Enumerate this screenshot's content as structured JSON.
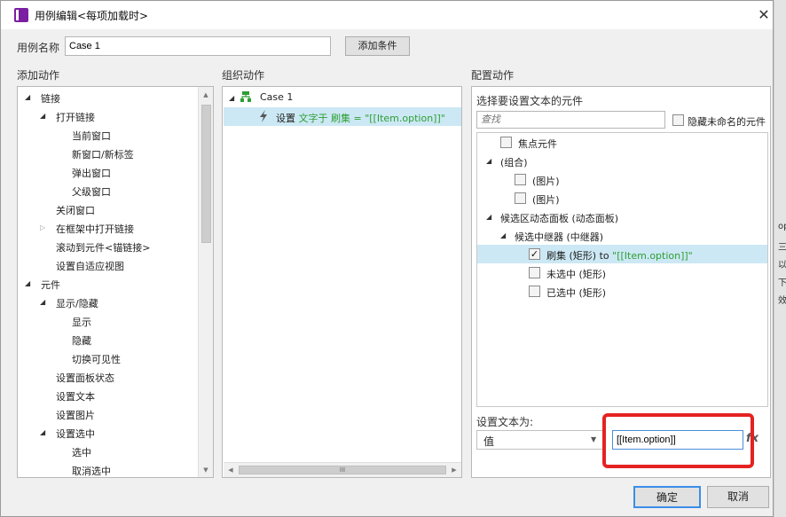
{
  "window": {
    "title": "用例编辑<每项加载时>",
    "icon_label": "RP"
  },
  "case_name": {
    "label": "用例名称",
    "value": "Case 1",
    "add_condition_button": "添加条件"
  },
  "sections": {
    "add_action": "添加动作",
    "organize_action": "组织动作",
    "configure_action": "配置动作"
  },
  "add_actions": [
    {
      "label": "链接",
      "level": 0,
      "expander": "open"
    },
    {
      "label": "打开链接",
      "level": 1,
      "expander": "open"
    },
    {
      "label": "当前窗口",
      "level": 2,
      "expander": "none"
    },
    {
      "label": "新窗口/新标签",
      "level": 2,
      "expander": "none"
    },
    {
      "label": "弹出窗口",
      "level": 2,
      "expander": "none"
    },
    {
      "label": "父级窗口",
      "level": 2,
      "expander": "none"
    },
    {
      "label": "关闭窗口",
      "level": 1,
      "expander": "none"
    },
    {
      "label": "在框架中打开链接",
      "level": 1,
      "expander": "closed"
    },
    {
      "label": "滚动到元件<锚链接>",
      "level": 1,
      "expander": "none"
    },
    {
      "label": "设置自适应视图",
      "level": 1,
      "expander": "none"
    },
    {
      "label": "元件",
      "level": 0,
      "expander": "open"
    },
    {
      "label": "显示/隐藏",
      "level": 1,
      "expander": "open"
    },
    {
      "label": "显示",
      "level": 2,
      "expander": "none"
    },
    {
      "label": "隐藏",
      "level": 2,
      "expander": "none"
    },
    {
      "label": "切换可见性",
      "level": 2,
      "expander": "none"
    },
    {
      "label": "设置面板状态",
      "level": 1,
      "expander": "none"
    },
    {
      "label": "设置文本",
      "level": 1,
      "expander": "none"
    },
    {
      "label": "设置图片",
      "level": 1,
      "expander": "none"
    },
    {
      "label": "设置选中",
      "level": 1,
      "expander": "open"
    },
    {
      "label": "选中",
      "level": 2,
      "expander": "none"
    },
    {
      "label": "取消选中",
      "level": 2,
      "expander": "none"
    }
  ],
  "organize": {
    "case_label": "Case 1",
    "action_prefix": "设置",
    "action_detail": "文字于 刷集 = \"[[Item.option]]\"",
    "hscroll_grip": "III"
  },
  "configure": {
    "select_widget_label": "选择要设置文本的元件",
    "search_placeholder": "查找",
    "hide_unnamed_label": "隐藏未命名的元件",
    "widgets": [
      {
        "label": "焦点元件",
        "checkbox": true,
        "checked": false,
        "expander": "none",
        "level": 0
      },
      {
        "label": "(组合)",
        "checkbox": false,
        "checked": false,
        "expander": "open",
        "level": 0
      },
      {
        "label": "(图片)",
        "checkbox": true,
        "checked": false,
        "expander": "none",
        "level": 1
      },
      {
        "label": "(图片)",
        "checkbox": true,
        "checked": false,
        "expander": "none",
        "level": 1
      },
      {
        "label": "候选区动态面板 (动态面板)",
        "checkbox": false,
        "checked": false,
        "expander": "open",
        "level": 0
      },
      {
        "label": "候选中继器 (中继器)",
        "checkbox": false,
        "checked": false,
        "expander": "open",
        "level": 1
      },
      {
        "label": "刷集 (矩形)",
        "suffix": "to",
        "value": "\"[[Item.option]]\"",
        "checkbox": true,
        "checked": true,
        "expander": "none",
        "level": 2,
        "selected": true
      },
      {
        "label": "未选中 (矩形)",
        "checkbox": true,
        "checked": false,
        "expander": "none",
        "level": 2
      },
      {
        "label": "已选中 (矩形)",
        "checkbox": true,
        "checked": false,
        "expander": "none",
        "level": 2
      }
    ],
    "set_text_label": "设置文本为:",
    "type_select_value": "值",
    "value_input": "[[Item.option]]",
    "fx_label": "fx"
  },
  "buttons": {
    "ok": "确定",
    "cancel": "取消"
  },
  "right_strip_chars": [
    "op",
    "三",
    "以",
    "下",
    "效"
  ],
  "colors": {
    "highlight_red": "#e52222",
    "selection": "#cce8f4",
    "action_green": "#2e9e34"
  }
}
